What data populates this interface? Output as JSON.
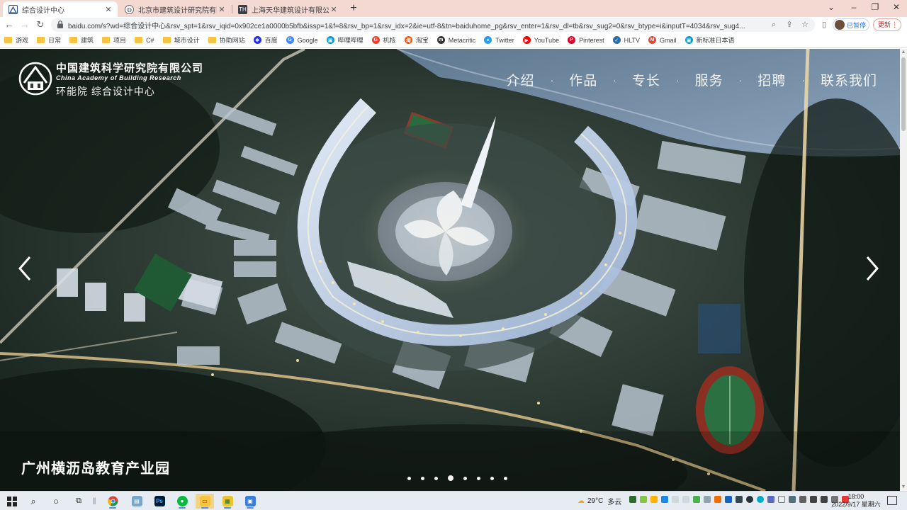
{
  "browser": {
    "tabs": [
      {
        "title": "综合设计中心",
        "favicon": "logo-icon",
        "active": true
      },
      {
        "title": "北京市建筑设计研究院有限公司",
        "favicon": "globe-icon",
        "active": false
      },
      {
        "title": "上海天华建筑设计有限公司官网",
        "favicon": "th-icon",
        "favicon_text": "TH",
        "active": false
      }
    ],
    "new_tab_icon": "plus-icon",
    "window_controls": {
      "minimize": "–",
      "restore": "❐",
      "close": "✕"
    },
    "url": "baidu.com/s?wd=综合设计中心&rsv_spt=1&rsv_iqid=0x902ce1a0000b5bfb&issp=1&f=8&rsv_bp=1&rsv_idx=2&ie=utf-8&tn=baiduhome_pg&rsv_enter=1&rsv_dl=tb&rsv_sug2=0&rsv_btype=i&inputT=4034&rsv_sug4...",
    "profile_label": "已暂停",
    "update_label": "更新"
  },
  "bookmarks": [
    {
      "label": "游戏",
      "icon": "folder"
    },
    {
      "label": "日常",
      "icon": "folder"
    },
    {
      "label": "建筑",
      "icon": "folder"
    },
    {
      "label": "项目",
      "icon": "folder"
    },
    {
      "label": "C#",
      "icon": "folder"
    },
    {
      "label": "城市设计",
      "icon": "folder"
    },
    {
      "label": "协助网站",
      "icon": "folder"
    },
    {
      "label": "百度",
      "icon": "baidu",
      "color": "#2932e1"
    },
    {
      "label": "Google",
      "icon": "google",
      "color": "#4285f4"
    },
    {
      "label": "哔哩哔哩",
      "icon": "bilibili",
      "color": "#00a1d6"
    },
    {
      "label": "机核",
      "icon": "gcores",
      "color": "#f33c2f"
    },
    {
      "label": "淘宝",
      "icon": "taobao",
      "color": "#ff5000"
    },
    {
      "label": "Metacritic",
      "icon": "metacritic",
      "color": "#333333"
    },
    {
      "label": "Twitter",
      "icon": "twitter",
      "color": "#1da1f2"
    },
    {
      "label": "YouTube",
      "icon": "youtube",
      "color": "#ff0000"
    },
    {
      "label": "Pinterest",
      "icon": "pinterest",
      "color": "#e60023"
    },
    {
      "label": "HLTV",
      "icon": "hltv",
      "color": "#2b6ea4"
    },
    {
      "label": "Gmail",
      "icon": "gmail",
      "color": "#ea4335"
    },
    {
      "label": "新标准日本语",
      "icon": "bilibili",
      "color": "#00a1d6"
    }
  ],
  "site": {
    "logo_cn": "中国建筑科学研究院有限公司",
    "logo_en": "China Academy of Building Research",
    "logo_sub": "环能院  综合设计中心",
    "nav": [
      "介绍",
      "作品",
      "专长",
      "服务",
      "招聘",
      "联系我们"
    ],
    "nav_separator": "·",
    "caption": "广州横沥岛教育产业园",
    "carousel": {
      "total": 8,
      "active": 4
    },
    "accent_color": "#ffffff"
  },
  "taskbar": {
    "weather_temp": "29°C",
    "weather_desc": "多云",
    "time": "18:00",
    "date": "2022/9/17 星期六",
    "apps": [
      "chrome-icon",
      "files-icon",
      "photoshop-icon",
      "wechat-icon",
      "folder-icon",
      "notes-icon",
      "presentation-icon"
    ]
  }
}
